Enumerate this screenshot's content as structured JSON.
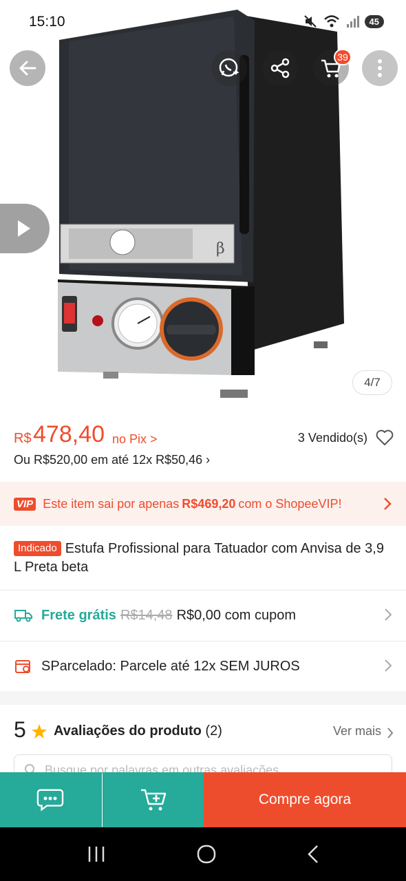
{
  "status_bar": {
    "time": "15:10",
    "battery": "45"
  },
  "header": {
    "back_icon": "arrow-left-icon",
    "whatsapp_icon": "whatsapp-icon",
    "share_icon": "share-icon",
    "cart_icon": "cart-icon",
    "cart_count": "39",
    "more_icon": "more-vertical-icon"
  },
  "gallery": {
    "counter": "4/7",
    "play_icon": "play-icon"
  },
  "product_label_text": "β",
  "price": {
    "currency": "R$",
    "value": "478,40",
    "suffix": "no Pix >",
    "sold": "3 Vendido(s)",
    "installments": "Ou R$520,00 em até 12x R$50,46 ›"
  },
  "vip": {
    "logo": "VIP",
    "text_before": "Este item sai por apenas",
    "amount": "R$469,20",
    "text_after": "com o ShopeeVIP!"
  },
  "title": {
    "tag": "Indicado",
    "text": "Estufa Profissional para Tatuador com Anvisa de 3,9 L Preta beta"
  },
  "shipping": {
    "free_label": "Frete grátis",
    "old_price": "R$14,48",
    "new_price": "R$0,00 com cupom"
  },
  "installment_offer": {
    "text": "SParcelado: Parcele até 12x SEM JUROS"
  },
  "reviews": {
    "rating": "5",
    "title": "Avaliações do produto",
    "count": "(2)",
    "see_more": "Ver mais",
    "search_placeholder": "Busque por palavras em outras avaliações"
  },
  "actions": {
    "buy_now": "Compre agora"
  },
  "colors": {
    "brand": "#ee4d2d",
    "teal": "#26aa99"
  }
}
